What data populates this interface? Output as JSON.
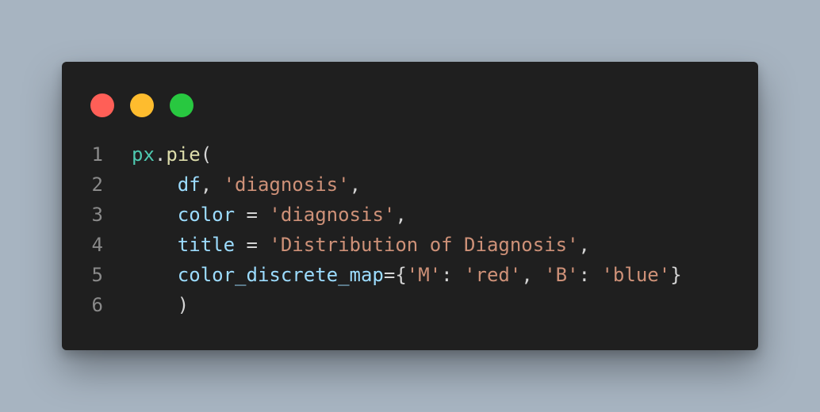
{
  "window": {
    "title": "",
    "controls": {
      "close_color": "#ff5f57",
      "minimize_color": "#febc2e",
      "maximize_color": "#28c840"
    }
  },
  "colors": {
    "background": "#a7b4c1",
    "editor": "#1f1f1f",
    "line_number": "#8a8a8a",
    "module": "#4ec9b0",
    "function": "#dcdcaa",
    "variable": "#9cdcfe",
    "string": "#ce9178",
    "punctuation": "#d4d4d4"
  },
  "code": {
    "language": "python",
    "lines": [
      {
        "number": "1",
        "indent": "",
        "tokens": [
          {
            "type": "module",
            "text": "px"
          },
          {
            "type": "punct",
            "text": "."
          },
          {
            "type": "func",
            "text": "pie"
          },
          {
            "type": "punct",
            "text": "("
          }
        ]
      },
      {
        "number": "2",
        "indent": "    ",
        "tokens": [
          {
            "type": "var",
            "text": "df"
          },
          {
            "type": "punct",
            "text": ", "
          },
          {
            "type": "str",
            "text": "'diagnosis'"
          },
          {
            "type": "punct",
            "text": ","
          }
        ]
      },
      {
        "number": "3",
        "indent": "    ",
        "tokens": [
          {
            "type": "var",
            "text": "color"
          },
          {
            "type": "punct",
            "text": " = "
          },
          {
            "type": "str",
            "text": "'diagnosis'"
          },
          {
            "type": "punct",
            "text": ","
          }
        ]
      },
      {
        "number": "4",
        "indent": "    ",
        "tokens": [
          {
            "type": "var",
            "text": "title"
          },
          {
            "type": "punct",
            "text": " = "
          },
          {
            "type": "str",
            "text": "'Distribution of Diagnosis'"
          },
          {
            "type": "punct",
            "text": ","
          }
        ]
      },
      {
        "number": "5",
        "indent": "    ",
        "tokens": [
          {
            "type": "var",
            "text": "color_discrete_map"
          },
          {
            "type": "punct",
            "text": "={"
          },
          {
            "type": "str",
            "text": "'M'"
          },
          {
            "type": "punct",
            "text": ": "
          },
          {
            "type": "str",
            "text": "'red'"
          },
          {
            "type": "punct",
            "text": ", "
          },
          {
            "type": "str",
            "text": "'B'"
          },
          {
            "type": "punct",
            "text": ": "
          },
          {
            "type": "str",
            "text": "'blue'"
          },
          {
            "type": "punct",
            "text": "}"
          }
        ]
      },
      {
        "number": "6",
        "indent": "    ",
        "tokens": [
          {
            "type": "punct",
            "text": ")"
          }
        ]
      }
    ]
  }
}
